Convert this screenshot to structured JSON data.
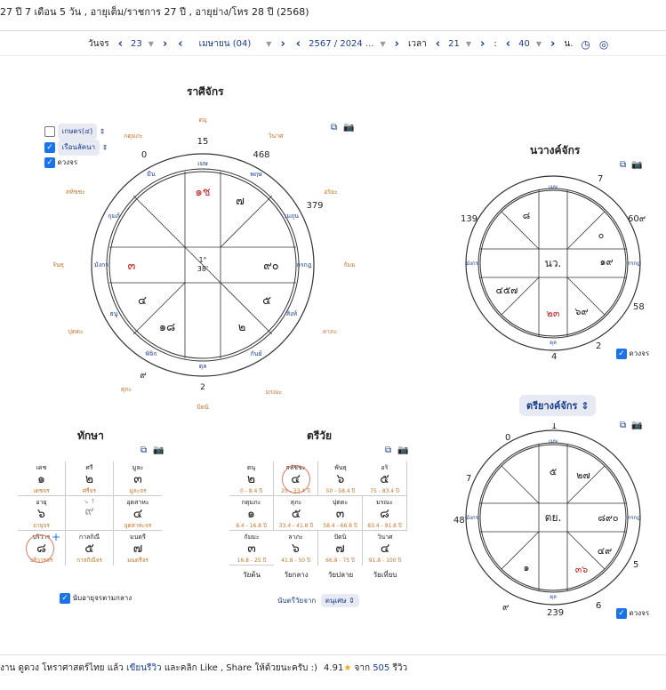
{
  "header": {
    "age_text": "27 ปี 7 เดือน 5 วัน , อายุเต็ม/ราชการ 27 ปี , อายุย่าง/โหร 28 ปี (2568)"
  },
  "nav": {
    "day_label": "วันจร",
    "day_value": "23",
    "month_value": "เมษายน (04)",
    "year_value": "2567 / 2024 ...",
    "time_label": "เวลา",
    "hour_value": "21",
    "minute_value": "40",
    "unit": "น."
  },
  "rasi": {
    "title": "ราศีจักร",
    "options": [
      {
        "label": "เกษตร(๔)",
        "checked": false
      },
      {
        "label": "เรือนลัคนา",
        "checked": true
      },
      {
        "label": "ดวงจร",
        "checked": true
      }
    ],
    "outer_labels": [
      "ธนุ",
      "วินาศ",
      "อริยะ",
      "กัมม",
      "ลาภะ",
      "มรณะ",
      "ปัตนิ",
      "สุภะ",
      "ปุตตะ",
      "พันธุ",
      "สหัชชะ",
      "กดุมภะ",
      "ตนุ"
    ],
    "outer_numbers": [
      "15",
      "468",
      "379",
      "0",
      "๙",
      "2"
    ],
    "center_values": [
      "1°",
      "38'"
    ],
    "houses": [
      "๑",
      "๗",
      "๙๐",
      "๕",
      "๒",
      "๑๘",
      "๔",
      "๓"
    ],
    "lagna_marker": "๑ช",
    "red_marker": "๓"
  },
  "nawang": {
    "title": "นวางค์จักร",
    "center": "นว.",
    "outer_numbers": [
      "7",
      "139",
      "60๙",
      "58",
      "2",
      "4"
    ],
    "cells": [
      "๘",
      "๐",
      "๑๙",
      "๔๕๗",
      "๒๓",
      "๖๙"
    ],
    "checkbox_label": "ดวงจร"
  },
  "triyang": {
    "title": "ตรียางค์จักร",
    "center": "ตย.",
    "outer_numbers": [
      "1",
      "0",
      "7",
      "48",
      "5",
      "6",
      "239",
      "๙"
    ],
    "cells": [
      "๕",
      "๒๗",
      "๘๙๐",
      "๔๙",
      "๑",
      "๓๖"
    ],
    "checkbox_label": "ดวงจร"
  },
  "taksa": {
    "title": "ทักษา",
    "cells": [
      {
        "top": "เดช",
        "num": "๑",
        "bot": "เดชจร"
      },
      {
        "top": "ศรี",
        "num": "๒",
        "bot": "ศรีจร"
      },
      {
        "top": "มูละ",
        "num": "๓",
        "bot": "มูละจร"
      },
      {
        "top": "อายุ",
        "num": "๖",
        "bot": "อายุจร"
      },
      {
        "top": "",
        "num": "๙",
        "bot": ""
      },
      {
        "top": "อุตสาหะ",
        "num": "๔",
        "bot": "อุตสาหะจร"
      },
      {
        "top": "บริวาร",
        "num": "๘",
        "bot": "บริวารจร"
      },
      {
        "top": "กาลกิณี",
        "num": "๕",
        "bot": "กาลกิณีจร"
      },
      {
        "top": "มนตรี",
        "num": "๗",
        "bot": "มนตรีจร"
      }
    ],
    "checkbox_label": "นับอายุจรตามกลาง"
  },
  "triwai": {
    "title": "ตรีวัย",
    "cells": [
      {
        "top": "ตนุ",
        "num": "๒",
        "bot": "0 - 8.4 ปี"
      },
      {
        "top": "สหัชชะ",
        "num": "๔",
        "bot": "25 - 33.4 ปี"
      },
      {
        "top": "พันธุ",
        "num": "๖",
        "bot": "50 - 58.4 ปี"
      },
      {
        "top": "อริ",
        "num": "๕",
        "bot": "75 - 83.4 ปี"
      },
      {
        "top": "กดุมภะ",
        "num": "๑",
        "bot": "8.4 - 16.8 ปี"
      },
      {
        "top": "สุภะ",
        "num": "๕",
        "bot": "33.4 - 41.8 ปี"
      },
      {
        "top": "ปุตตะ",
        "num": "๓",
        "bot": "58.4 - 66.8 ปี"
      },
      {
        "top": "มรณะ",
        "num": "๘",
        "bot": "83.4 - 91.8 ปี"
      },
      {
        "top": "กัมมะ",
        "num": "๓",
        "bot": "16.8 - 25 ปี"
      },
      {
        "top": "ลาภะ",
        "num": "๖",
        "bot": "41.8 - 50 ปี"
      },
      {
        "top": "ปัตนิ",
        "num": "๗",
        "bot": "66.8 - 75 ปี"
      },
      {
        "top": "วินาศ",
        "num": "๔",
        "bot": "91.8 - 100 ปี"
      }
    ],
    "age_groups": [
      "วัยต้น",
      "วัยกลาง",
      "วัยปลาย",
      "วัยเที่ยบ"
    ],
    "count_label": "นับตรีวัยจาก",
    "count_value": "ตนุเศษ"
  },
  "footer": {
    "text": "งาน ดูดวง โหราศาสตร์ไทย แล้ว",
    "review_link": "เขียนรีวิว",
    "text2": "และคลิก Like , Share ให้ด้วยนะครับ :)",
    "rating": "4.91",
    "from": "จาก",
    "count": "505",
    "review_word": "รีวิว"
  },
  "colors": {
    "accent": "#1a3d8f",
    "orange": "#c8742a",
    "red": "#c62828",
    "check": "#1a73e8"
  }
}
